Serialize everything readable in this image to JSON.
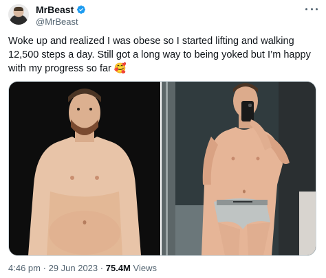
{
  "author": {
    "display_name": "MrBeast",
    "handle": "@MrBeast",
    "verified_icon": "verified-badge-icon",
    "badge_color": "#1d9bf0"
  },
  "tweet": {
    "text": "Woke up and realized I was obese so I started lifting and walking 12,500 steps a day. Still got a long way to being yoked but I’m happy with my progress so far 🥰"
  },
  "media": {
    "count": 2,
    "images": [
      "before-photo",
      "after-mirror-selfie"
    ]
  },
  "meta": {
    "time": "4:46 pm",
    "date": "29 Jun 2023",
    "separator": "·",
    "views_count": "75.4M",
    "views_label": "Views"
  },
  "colors": {
    "text": "#0f1419",
    "secondary": "#536471",
    "border": "#cfd9de"
  }
}
